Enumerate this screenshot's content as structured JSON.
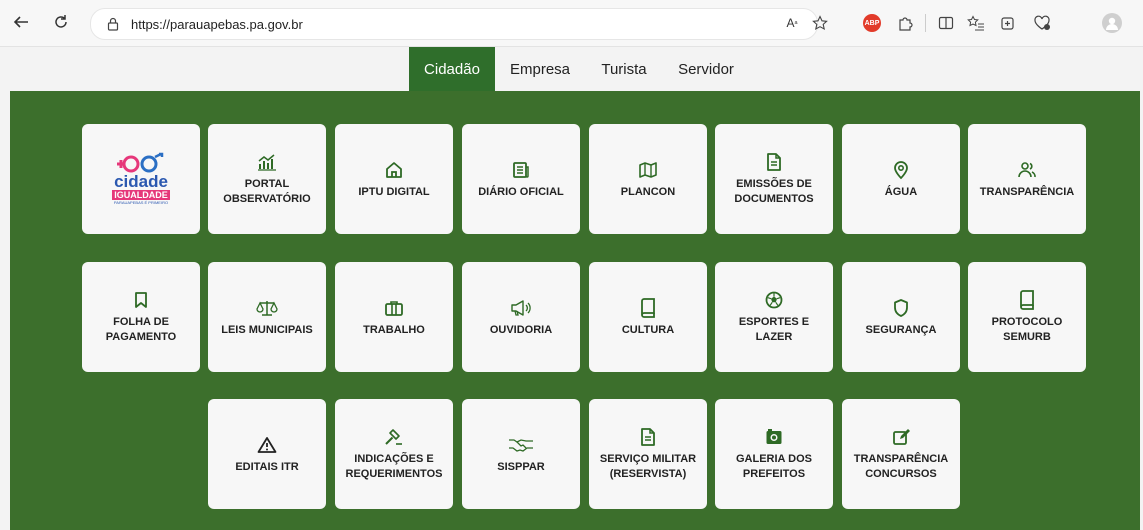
{
  "browser": {
    "url": "https://parauapebas.pa.gov.br",
    "adblock_label": "ABP"
  },
  "header": {
    "tabs": [
      {
        "label": "Cidadão",
        "active": true
      },
      {
        "label": "Empresa",
        "active": false
      },
      {
        "label": "Turista",
        "active": false
      },
      {
        "label": "Servidor",
        "active": false
      }
    ]
  },
  "logo": {
    "line1": "cidade",
    "line2": "IGUALDADE",
    "tagline": "PARAUAPEBAS É PRIMEIRO"
  },
  "services": [
    {
      "label": "PORTAL OBSERVATÓRIO",
      "icon": "chart-icon"
    },
    {
      "label": "IPTU DIGITAL",
      "icon": "home-icon"
    },
    {
      "label": "DIÁRIO OFICIAL",
      "icon": "newspaper-icon"
    },
    {
      "label": "PLANCON",
      "icon": "map-icon"
    },
    {
      "label": "EMISSÕES DE DOCUMENTOS",
      "icon": "document-icon"
    },
    {
      "label": "ÁGUA",
      "icon": "location-pin-icon"
    },
    {
      "label": "TRANSPARÊNCIA",
      "icon": "users-icon"
    },
    {
      "label": "FOLHA DE PAGAMENTO",
      "icon": "bookmark-icon"
    },
    {
      "label": "LEIS MUNICIPAIS",
      "icon": "scales-icon"
    },
    {
      "label": "TRABALHO",
      "icon": "briefcase-icon"
    },
    {
      "label": "OUVIDORIA",
      "icon": "megaphone-icon"
    },
    {
      "label": "CULTURA",
      "icon": "book-icon"
    },
    {
      "label": "ESPORTES E LAZER",
      "icon": "soccer-ball-icon"
    },
    {
      "label": "SEGURANÇA",
      "icon": "shield-icon"
    },
    {
      "label": "PROTOCOLO SEMURB",
      "icon": "book-icon"
    },
    {
      "label": "EDITAIS ITR",
      "icon": "warning-icon"
    },
    {
      "label": "INDICAÇÕES E REQUERIMENTOS",
      "icon": "gavel-icon"
    },
    {
      "label": "SISPPAR",
      "icon": "handshake-icon"
    },
    {
      "label": "SERVIÇO MILITAR (RESERVISTA)",
      "icon": "document-icon"
    },
    {
      "label": "GALERIA DOS PREFEITOS",
      "icon": "camera-icon"
    },
    {
      "label": "TRANSPARÊNCIA CONCURSOS",
      "icon": "edit-icon"
    }
  ],
  "colors": {
    "green": "#3c6f2c",
    "active_tab": "#2f6e2b",
    "icon": "#2e6a25"
  }
}
